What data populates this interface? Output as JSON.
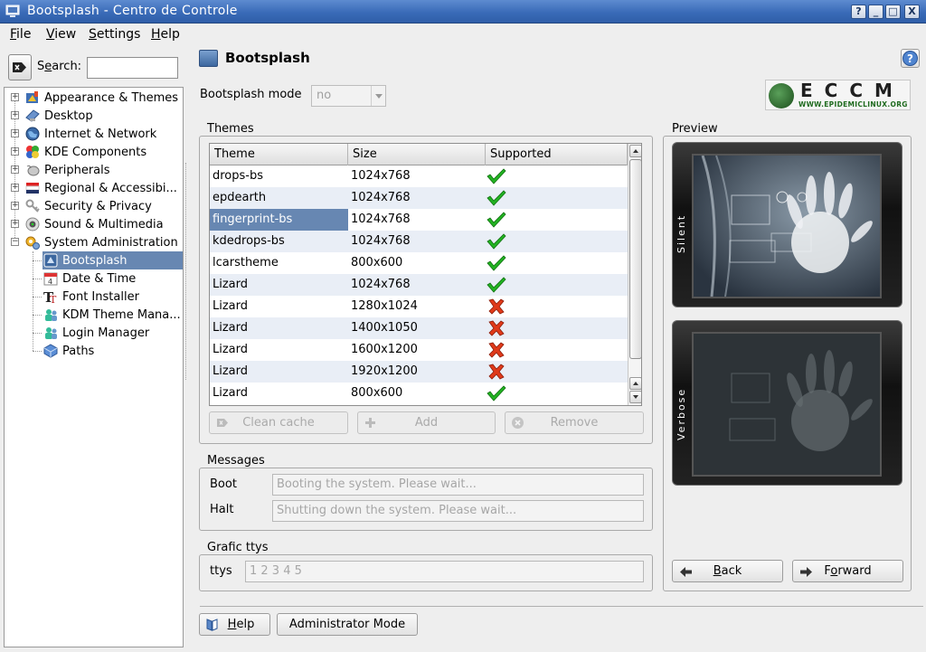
{
  "window": {
    "title": "Bootsplash - Centro de Controle",
    "controls": [
      "?",
      "_",
      "□",
      "X"
    ]
  },
  "menu": [
    {
      "label": "File",
      "mnemonic": "F",
      "rest": "ile"
    },
    {
      "label": "View",
      "mnemonic": "V",
      "rest": "iew"
    },
    {
      "label": "Settings",
      "mnemonic": "S",
      "rest": "ettings"
    },
    {
      "label": "Help",
      "mnemonic": "H",
      "rest": "elp"
    }
  ],
  "search": {
    "label_prefix": "S",
    "label_mnemonic": "e",
    "label_rest": "arch:",
    "value": ""
  },
  "tree": {
    "categories": [
      {
        "label": "Appearance & Themes",
        "icon": "appearance-icon",
        "expanded": false
      },
      {
        "label": "Desktop",
        "icon": "desktop-icon",
        "expanded": false
      },
      {
        "label": "Internet & Network",
        "icon": "globe-icon",
        "expanded": false
      },
      {
        "label": "KDE Components",
        "icon": "components-icon",
        "expanded": false
      },
      {
        "label": "Peripherals",
        "icon": "mouse-icon",
        "expanded": false
      },
      {
        "label": "Regional & Accessibi...",
        "icon": "flag-icon",
        "expanded": false
      },
      {
        "label": "Security & Privacy",
        "icon": "key-icon",
        "expanded": false
      },
      {
        "label": "Sound & Multimedia",
        "icon": "speaker-icon",
        "expanded": false
      },
      {
        "label": "System Administration",
        "icon": "gears-icon",
        "expanded": true
      }
    ],
    "children": [
      {
        "label": "Bootsplash",
        "icon": "bootsplash-icon",
        "selected": true
      },
      {
        "label": "Date & Time",
        "icon": "calendar-icon",
        "selected": false
      },
      {
        "label": "Font Installer",
        "icon": "font-icon",
        "selected": false
      },
      {
        "label": "KDM Theme Mana...",
        "icon": "kdm-theme-icon",
        "selected": false
      },
      {
        "label": "Login Manager",
        "icon": "login-icon",
        "selected": false
      },
      {
        "label": "Paths",
        "icon": "paths-icon",
        "selected": false
      }
    ]
  },
  "module": {
    "title": "Bootsplash",
    "mode_label": "Bootsplash mode",
    "mode_value": "no",
    "logo_text": "ECCM",
    "logo_url_text": "WWW.EPIDEMICLINUX.ORG"
  },
  "themes": {
    "group_title": "Themes",
    "columns": [
      "Theme",
      "Size",
      "Supported"
    ],
    "rows": [
      {
        "name": "drops-bs",
        "size": "1024x768",
        "supported": true
      },
      {
        "name": "epdearth",
        "size": "1024x768",
        "supported": true
      },
      {
        "name": "fingerprint-bs",
        "size": "1024x768",
        "supported": true,
        "selected": true
      },
      {
        "name": "kdedrops-bs",
        "size": "1024x768",
        "supported": true
      },
      {
        "name": "lcarstheme",
        "size": "800x600",
        "supported": true
      },
      {
        "name": "Lizard",
        "size": "1024x768",
        "supported": true
      },
      {
        "name": "Lizard",
        "size": "1280x1024",
        "supported": false
      },
      {
        "name": "Lizard",
        "size": "1400x1050",
        "supported": false
      },
      {
        "name": "Lizard",
        "size": "1600x1200",
        "supported": false
      },
      {
        "name": "Lizard",
        "size": "1920x1200",
        "supported": false
      },
      {
        "name": "Lizard",
        "size": "800x600",
        "supported": true
      }
    ],
    "buttons": {
      "clean_cache": "Clean cache",
      "add": "Add",
      "remove": "Remove"
    }
  },
  "messages": {
    "group_title": "Messages",
    "boot_label": "Boot",
    "boot_value": "Booting the system. Please wait...",
    "halt_label": "Halt",
    "halt_value": "Shutting down the system. Please wait..."
  },
  "grafic": {
    "group_title": "Grafic ttys",
    "ttys_label": "ttys",
    "ttys_value": "1 2 3 4 5"
  },
  "preview": {
    "group_title": "Preview",
    "silent_label": "Silent",
    "verbose_label": "Verbose",
    "back_label": "Back",
    "back_mnemonic": "B",
    "back_rest": "ack",
    "forward_prefix": "F",
    "forward_mnemonic": "o",
    "forward_rest": "rward"
  },
  "footer": {
    "help_label": "Help",
    "help_mnemonic": "H",
    "help_rest": "elp",
    "admin_label": "Administrator Mode"
  },
  "colors": {
    "selection": "#6787b2",
    "check": "#22b322",
    "cross": "#e03a1a"
  }
}
